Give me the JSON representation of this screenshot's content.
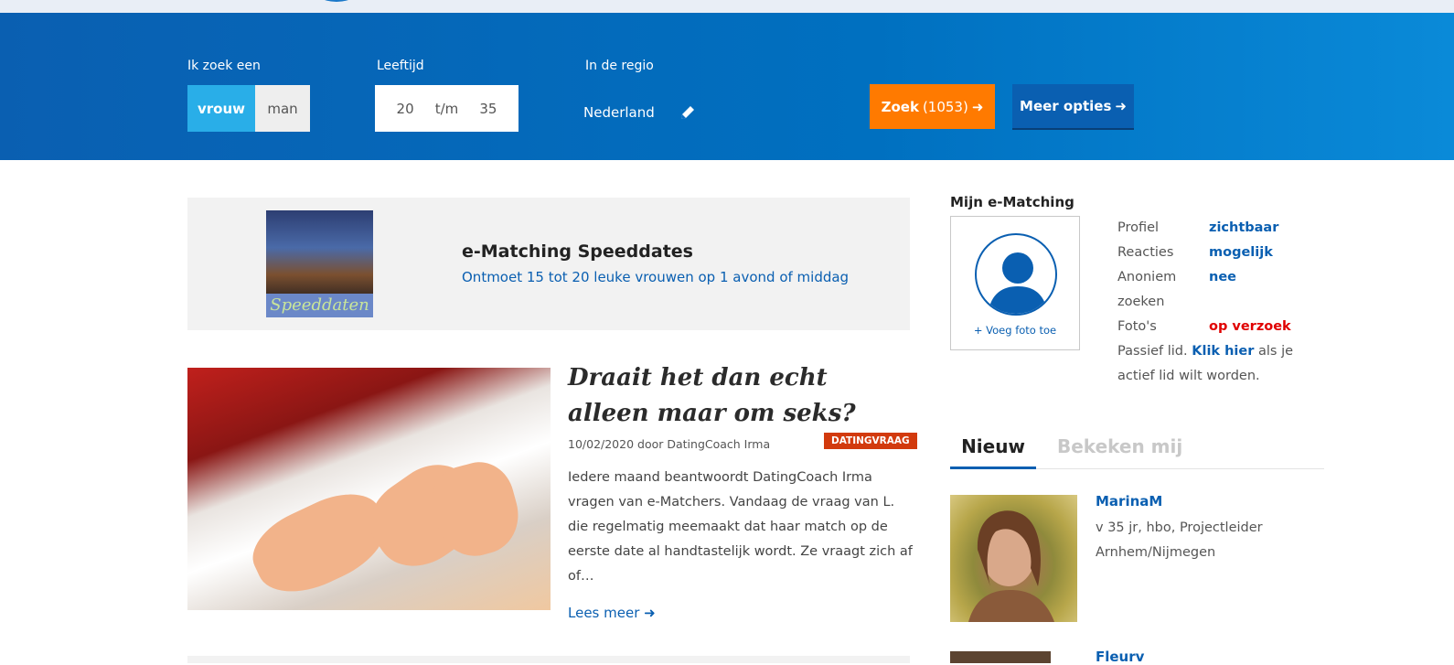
{
  "search": {
    "gender_label": "Ik zoek een",
    "gender_options": [
      "vrouw",
      "man"
    ],
    "gender_selected": "vrouw",
    "age_label": "Leeftijd",
    "age_min": "20",
    "age_sep": "t/m",
    "age_max": "35",
    "region_label": "In de regio",
    "region_value": "Nederland",
    "search_button": "Zoek",
    "search_count": "(1053)",
    "more_button": "Meer opties"
  },
  "promo": {
    "image_caption": "Speeddaten",
    "title": "e-Matching Speeddates",
    "subtitle": "Ontmoet 15 tot 20 leuke vrouwen op 1 avond of middag"
  },
  "article": {
    "title": "Draait het dan echt alleen maar om seks?",
    "meta": "10/02/2020 door DatingCoach Irma",
    "tag": "DATINGVRAAG",
    "body": "Iedere maand beantwoordt DatingCoach Irma vragen van e-Matchers. Vandaag de vraag van L. die regelmatig meemaakt dat haar match op de eerste date al handtastelijk wordt. Ze vraagt zich af of…",
    "read_more": "Lees meer"
  },
  "sidebar": {
    "title": "Mijn e-Matching",
    "add_photo": "+ Voeg foto toe",
    "status": [
      {
        "key": "Profiel",
        "value": "zichtbaar"
      },
      {
        "key": "Reacties",
        "value": "mogelijk"
      },
      {
        "key": "Anoniem zoeken",
        "value": "nee"
      },
      {
        "key": "Foto's",
        "value": "op verzoek"
      }
    ],
    "passive_prefix": "Passief lid.",
    "passive_link": "Klik hier",
    "passive_suffix": "als je actief lid wilt worden.",
    "tabs": [
      "Nieuw",
      "Bekeken mij"
    ],
    "members": [
      {
        "name": "MarinaM",
        "info": "v 35 jr, hbo, Projectleider Arnhem/Nijmegen"
      },
      {
        "name": "Fleurv"
      }
    ]
  },
  "colors": {
    "brand_blue": "#0a5fb1",
    "accent_orange": "#ff7a00",
    "selected_cyan": "#29aee8",
    "tag_red": "#d23a0d",
    "warning_red": "#e00000"
  }
}
